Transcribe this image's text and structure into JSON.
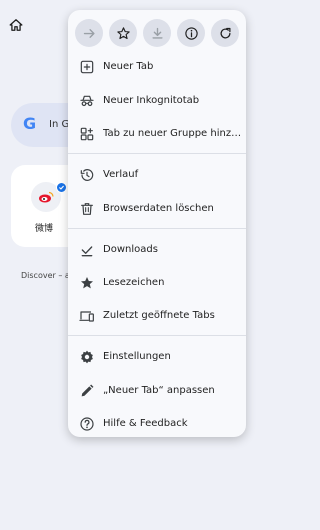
{
  "background": {
    "search_text": "In G",
    "google_logo": "G",
    "tile_label": "微博",
    "discover_text": "Discover – a"
  },
  "menu": {
    "toolbar": [
      {
        "icon": "forward-arrow-icon",
        "enabled": false
      },
      {
        "icon": "star-outline-icon",
        "enabled": true
      },
      {
        "icon": "download-icon",
        "enabled": false
      },
      {
        "icon": "info-icon",
        "enabled": true
      },
      {
        "icon": "refresh-icon",
        "enabled": true
      }
    ],
    "items": [
      {
        "label": "Neuer Tab",
        "icon": "plus-box-icon"
      },
      {
        "label": "Neuer Inkognitotab",
        "icon": "incognito-icon"
      },
      {
        "label": "Tab zu neuer Gruppe hinzufüg…",
        "icon": "tab-group-icon"
      },
      {
        "label": "Verlauf",
        "icon": "history-icon"
      },
      {
        "label": "Browserdaten löschen",
        "icon": "trash-icon"
      },
      {
        "label": "Downloads",
        "icon": "download-done-icon"
      },
      {
        "label": "Lesezeichen",
        "icon": "star-filled-icon"
      },
      {
        "label": "Zuletzt geöffnete Tabs",
        "icon": "devices-icon"
      },
      {
        "label": "Einstellungen",
        "icon": "gear-icon"
      },
      {
        "label": "„Neuer Tab“ anpassen",
        "icon": "pencil-icon"
      },
      {
        "label": "Hilfe & Feedback",
        "icon": "help-icon"
      }
    ]
  },
  "colors": {
    "accent": "#1a73e8",
    "icon": "#3c4043",
    "disabled_icon": "#9aa0a6"
  }
}
